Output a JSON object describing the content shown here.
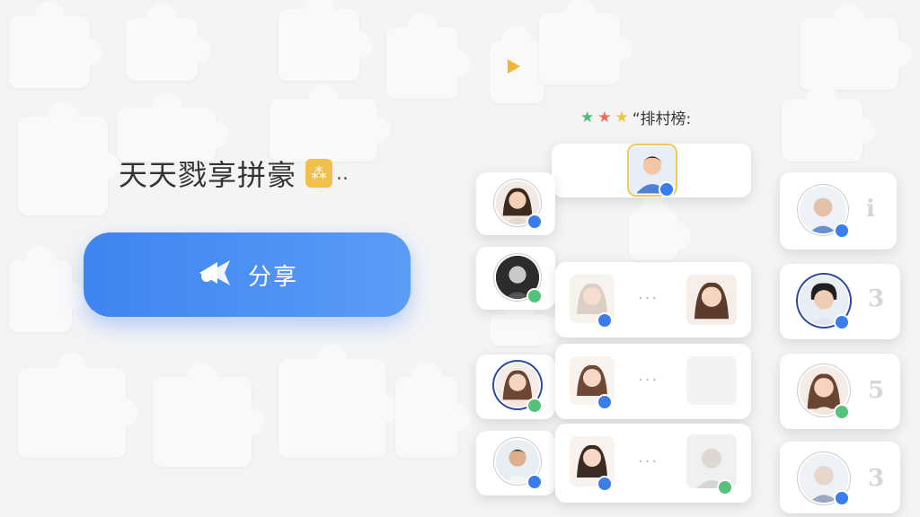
{
  "headline": {
    "title": "天天戮享拼豪",
    "badge_glyph": "⁂",
    "trailing": ".."
  },
  "share_button": {
    "label": "分享"
  },
  "leaderboard": {
    "title": "“排村榜:",
    "star_colors": [
      "#4cbf7a",
      "#ef6b5b",
      "#f3c43a"
    ]
  },
  "ellipsis_text": "···",
  "rank_numbers": [
    "i",
    "3",
    "5",
    "3"
  ],
  "colors": {
    "accent": "#4a8ef2",
    "gold": "#f3c43a",
    "ring": "#2d4aa0"
  }
}
